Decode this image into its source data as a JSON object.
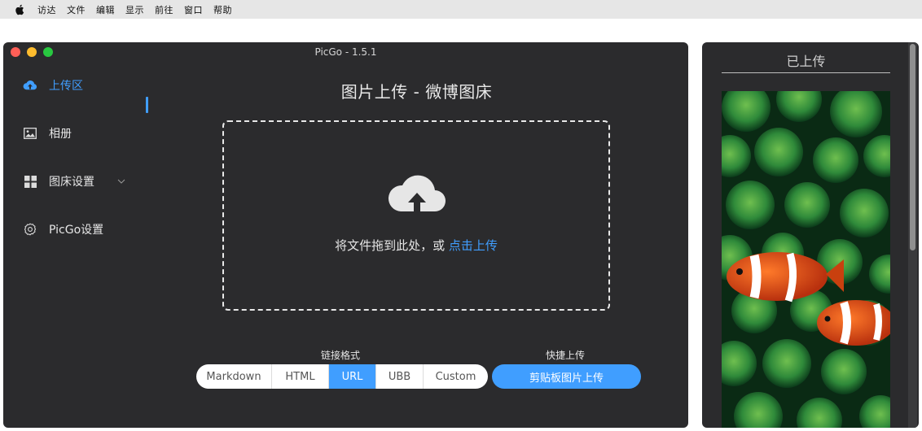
{
  "menubar": {
    "items": [
      "访达",
      "文件",
      "编辑",
      "显示",
      "前往",
      "窗口",
      "帮助"
    ]
  },
  "window": {
    "title": "PicGo - 1.5.1"
  },
  "sidebar": {
    "items": [
      {
        "label": "上传区",
        "icon": "cloud-upload-icon",
        "active": true
      },
      {
        "label": "相册",
        "icon": "picture-icon",
        "active": false
      },
      {
        "label": "图床设置",
        "icon": "grid-icon",
        "active": false
      },
      {
        "label": "PicGo设置",
        "icon": "gear-icon",
        "active": false
      }
    ]
  },
  "main": {
    "title": "图片上传 - 微博图床",
    "drop_text": "将文件拖到此处，或 ",
    "drop_link": "点击上传",
    "link_format_label": "链接格式",
    "quick_upload_label": "快捷上传",
    "formats": [
      {
        "label": "Markdown",
        "selected": false
      },
      {
        "label": "HTML",
        "selected": false
      },
      {
        "label": "URL",
        "selected": true
      },
      {
        "label": "UBB",
        "selected": false
      },
      {
        "label": "Custom",
        "selected": false
      }
    ],
    "clipboard_button": "剪贴板图片上传"
  },
  "uploaded_panel": {
    "title": "已上传"
  },
  "colors": {
    "accent": "#409eff",
    "window_bg": "#2b2b2d"
  }
}
